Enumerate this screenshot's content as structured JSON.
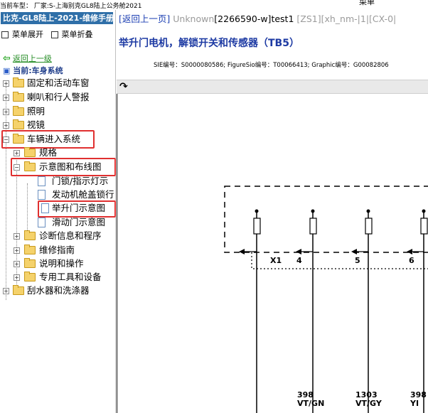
{
  "topbar": {
    "car_label": "当前车型： 厂家:S-上海别克GL8陆上公务舱2021",
    "menu_button": "菜单"
  },
  "sidebar": {
    "title": "比克-GL8陆上-2021-维修手册",
    "expand_label": "菜单展开",
    "collapse_label": "菜单折叠",
    "back_label": "返回上一级",
    "current_system": "当前:车身系统",
    "tree": [
      {
        "label": "固定和活动车窗"
      },
      {
        "label": "喇叭和行人警报"
      },
      {
        "label": "照明"
      },
      {
        "label": "视镜"
      },
      {
        "label": "车辆进入系统"
      },
      {
        "label": "规格"
      },
      {
        "label": "示意图和布线图"
      },
      {
        "label": "门锁/指示灯示"
      },
      {
        "label": "发动机舱盖锁行"
      },
      {
        "label": "举升门示意图"
      },
      {
        "label": "滑动门示意图"
      },
      {
        "label": "诊断信息和程序"
      },
      {
        "label": "维修指南"
      },
      {
        "label": "说明和操作"
      },
      {
        "label": "专用工具和设备"
      },
      {
        "label": "刮水器和洗涤器"
      }
    ]
  },
  "content": {
    "crumbs": {
      "back": "[返回上一页]",
      "unknown": "Unknown",
      "code": "[2266590-w]test1",
      "tags": "[ZS1][xh_nm-|1|[CX-0|"
    },
    "title": "举升门电机，解锁开关和传感器（TB5）",
    "sie_line": "SIE编号：S0000080586;  FigureSio编号：T00066413;  Graphic编号：G00082806",
    "diagram": {
      "connector": "X1",
      "pins": [
        "4",
        "5",
        "6"
      ],
      "wire_nums": [
        "398",
        "1303",
        "398"
      ],
      "wire_colors": [
        "VT/GN",
        "VT/GY",
        "YI"
      ]
    }
  }
}
